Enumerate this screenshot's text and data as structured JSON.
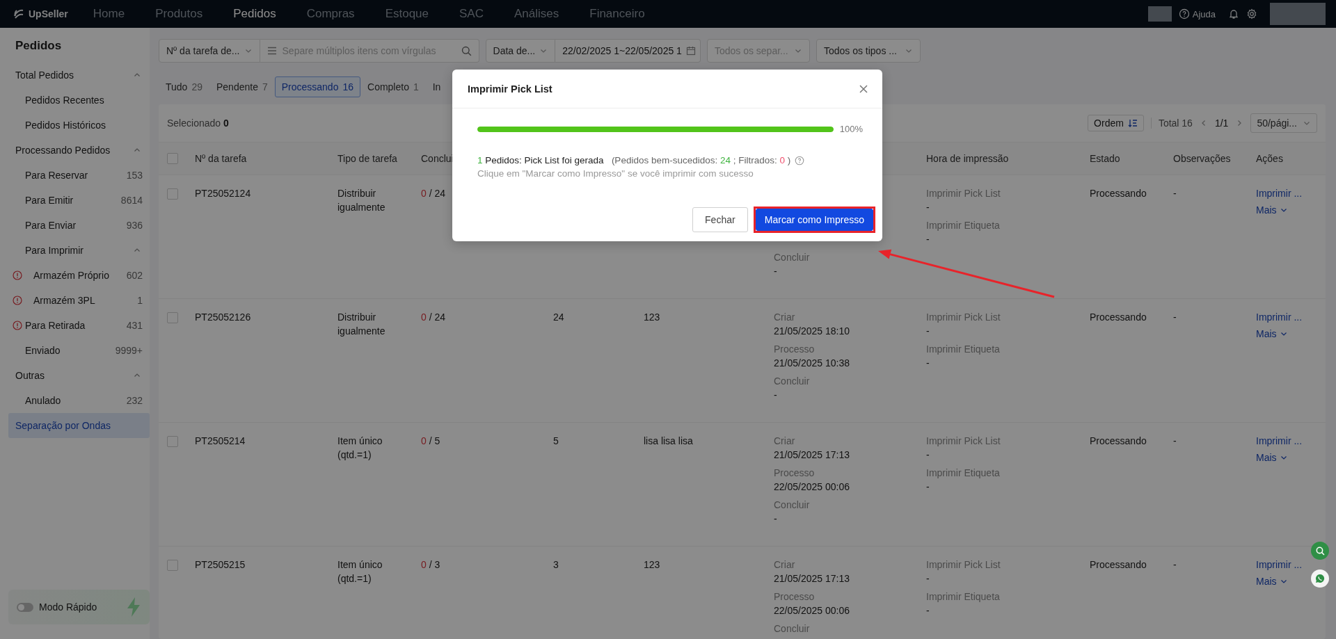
{
  "topbar": {
    "brand": "UpSeller",
    "nav": [
      {
        "label": "Home",
        "selected": false
      },
      {
        "label": "Produtos",
        "selected": false
      },
      {
        "label": "Pedidos",
        "selected": true
      },
      {
        "label": "Compras",
        "selected": false
      },
      {
        "label": "Estoque",
        "selected": false
      },
      {
        "label": "SAC",
        "selected": false
      },
      {
        "label": "Análises",
        "selected": false
      },
      {
        "label": "Financeiro",
        "selected": false
      }
    ],
    "help": "Ajuda"
  },
  "sidebar": {
    "title": "Pedidos",
    "items": [
      {
        "label": "Total Pedidos",
        "expanded": true,
        "selected": false,
        "children": [
          {
            "label": "Pedidos Recentes",
            "selected": false
          },
          {
            "label": "Pedidos Históricos",
            "selected": false
          }
        ]
      },
      {
        "label": "Processando Pedidos",
        "expanded": true,
        "selected": false,
        "children": [
          {
            "label": "Para Reservar",
            "count": "153",
            "selected": false
          },
          {
            "label": "Para Emitir",
            "count": "8614",
            "selected": false
          },
          {
            "label": "Para Enviar",
            "count": "936",
            "selected": false
          },
          {
            "label": "Para Imprimir",
            "expanded": true,
            "selected": false,
            "children": [
              {
                "label": "Armazém Próprio",
                "count": "602",
                "warning": true,
                "selected": false
              },
              {
                "label": "Armazém 3PL",
                "count": "1",
                "warning": true,
                "selected": false
              }
            ]
          },
          {
            "label": "Para Retirada",
            "count": "431",
            "warning": true,
            "selected": false
          },
          {
            "label": "Enviado",
            "count": "9999+",
            "selected": false
          }
        ]
      },
      {
        "label": "Outras",
        "expanded": true,
        "selected": false,
        "children": [
          {
            "label": "Anulado",
            "count": "232",
            "selected": false
          }
        ]
      },
      {
        "label": "Separação por Ondas",
        "selected": true
      }
    ],
    "fast_mode": {
      "label": "Modo Rápido",
      "on": false
    }
  },
  "filters": [
    [
      {
        "kind": "select",
        "value": "Nº da tarefa de..."
      },
      {
        "kind": "search",
        "placeholder": "Separe múltiplos itens com vírgulas"
      }
    ],
    [
      {
        "kind": "select",
        "value": "Data de..."
      },
      {
        "kind": "date",
        "value": "22/02/2025 1~22/05/2025 1"
      }
    ],
    [
      {
        "kind": "select",
        "placeholder": "Todos os separ..."
      }
    ],
    [
      {
        "kind": "select",
        "value": "Todos os tipos ..."
      }
    ]
  ],
  "tabs": [
    {
      "label": "Tudo",
      "count": "29",
      "selected": false
    },
    {
      "label": "Pendente",
      "count": "7",
      "selected": false
    },
    {
      "label": "Processando",
      "count": "16",
      "selected": true
    },
    {
      "label": "Completo",
      "count": "1",
      "selected": false
    },
    {
      "label": "In",
      "selected": false
    }
  ],
  "table": {
    "selected_text": "Selecionado **0**",
    "order": "Ordem",
    "total": "Total 16",
    "page": "1/1",
    "page_size": "50/pági...",
    "select_all": false,
    "columns": [
      "Nº da tarefa",
      "Tipo de tarefa",
      "Conclui",
      "Hora de impressão",
      "Estado",
      "Observações",
      "Ações"
    ],
    "rows": [
      {
        "checked": false,
        "id": "PT25052124",
        "type": "Distribuir igualmente",
        "done": "0",
        "total": "/ 24",
        "time": [
          {
            "label": "Concluir",
            "value": "-"
          }
        ],
        "print": [
          {
            "label": "Imprimir Pick List",
            "value": "-"
          },
          {
            "label": "Imprimir Etiqueta",
            "value": "-"
          }
        ],
        "status": "Processando",
        "notes": "-",
        "action": "Imprimir ...",
        "more": "Mais"
      },
      {
        "checked": false,
        "id": "PT25052126",
        "type": "Distribuir igualmente",
        "done": "0",
        "total": "/ 24",
        "column_4": "24",
        "column_5": "123",
        "time": [
          {
            "label": "Criar",
            "value": "21/05/2025 18:10"
          },
          {
            "label": "Processo",
            "value": "21/05/2025 10:38"
          },
          {
            "label": "Concluir",
            "value": "-"
          }
        ],
        "print": [
          {
            "label": "Imprimir Pick List",
            "value": "-"
          },
          {
            "label": "Imprimir Etiqueta",
            "value": "-"
          }
        ],
        "status": "Processando",
        "notes": "-",
        "action": "Imprimir ...",
        "more": "Mais"
      },
      {
        "checked": false,
        "id": "PT2505214",
        "type": "Item único (qtd.=1)",
        "done": "0",
        "total": "/ 5",
        "column_4": "5",
        "column_5": "lisa lisa lisa",
        "time": [
          {
            "label": "Criar",
            "value": "21/05/2025 17:13"
          },
          {
            "label": "Processo",
            "value": "22/05/2025 00:06"
          },
          {
            "label": "Concluir",
            "value": "-"
          }
        ],
        "print": [
          {
            "label": "Imprimir Pick List",
            "value": "-"
          },
          {
            "label": "Imprimir Etiqueta",
            "value": "-"
          }
        ],
        "status": "Processando",
        "notes": "-",
        "action": "Imprimir ...",
        "more": "Mais"
      },
      {
        "checked": false,
        "id": "PT2505215",
        "type": "Item único (qtd.=1)",
        "done": "0",
        "total": "/ 3",
        "column_4": "3",
        "column_5": "123",
        "time": [
          {
            "label": "Criar",
            "value": "21/05/2025 17:13"
          },
          {
            "label": "Processo",
            "value": "22/05/2025 00:06"
          },
          {
            "label": "Concluir"
          }
        ],
        "print": [
          {
            "label": "Imprimir Pick List",
            "value": "-"
          },
          {
            "label": "Imprimir Etiqueta",
            "value": "-"
          }
        ],
        "status": "Processando",
        "notes": "-",
        "action": "Imprimir ...",
        "more": "Mais"
      }
    ]
  },
  "modal": {
    "title": "Imprimir Pick List",
    "progress": {
      "level": 1,
      "reading": "100%"
    },
    "summary": {
      "count": "1",
      "text": "Pedidos: Pick List foi gerada",
      "detail_open": "(Pedidos bem-sucedidos:",
      "success": "24",
      "detail_mid": "; Filtrados:",
      "filtered": "0",
      "detail_close": ")"
    },
    "hint": "Clique em \"Marcar como Impresso\" se você imprimir com sucesso",
    "buttons": [
      {
        "label": "Fechar",
        "kind": "secondary",
        "highlighted": false
      },
      {
        "label": "Marcar como Impresso",
        "kind": "primary",
        "highlighted": true
      }
    ]
  }
}
